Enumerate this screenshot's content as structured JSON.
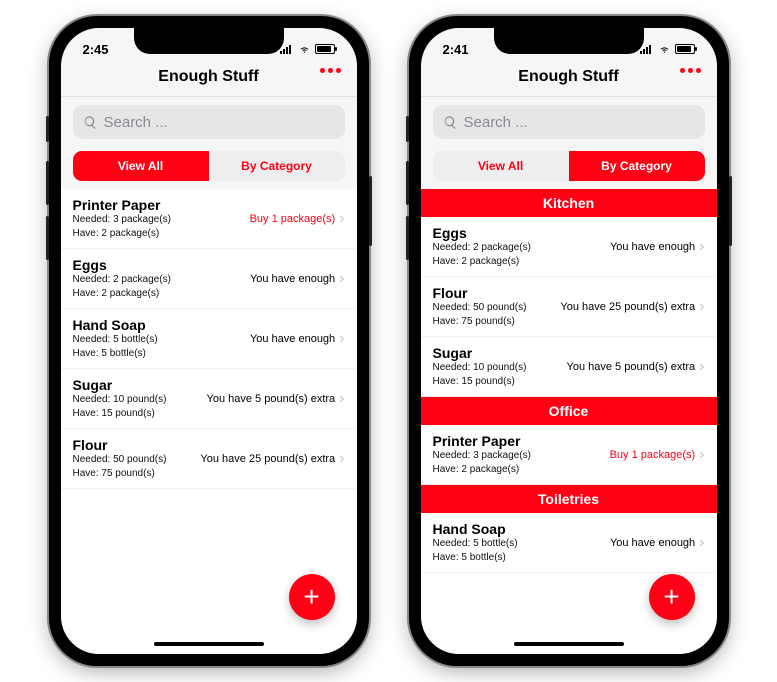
{
  "colors": {
    "accent": "#ff0015"
  },
  "phones": [
    {
      "id": "left",
      "status_time": "2:45",
      "title": "Enough Stuff",
      "search_placeholder": "Search ...",
      "segments": {
        "view_all": "View All",
        "by_category": "By Category",
        "active": "view_all"
      },
      "categories": [],
      "items": [
        {
          "name": "Printer Paper",
          "needed": "Needed: 3 package(s)",
          "have": "Have: 2 package(s)",
          "status": "Buy 1 package(s)",
          "status_kind": "buy"
        },
        {
          "name": "Eggs",
          "needed": "Needed: 2 package(s)",
          "have": "Have: 2 package(s)",
          "status": "You have enough",
          "status_kind": "ok"
        },
        {
          "name": "Hand Soap",
          "needed": "Needed: 5 bottle(s)",
          "have": "Have: 5 bottle(s)",
          "status": "You have enough",
          "status_kind": "ok"
        },
        {
          "name": "Sugar",
          "needed": "Needed: 10 pound(s)",
          "have": "Have: 15 pound(s)",
          "status": "You have 5 pound(s) extra",
          "status_kind": "ok"
        },
        {
          "name": "Flour",
          "needed": "Needed: 50 pound(s)",
          "have": "Have: 75 pound(s)",
          "status": "You have 25 pound(s) extra",
          "status_kind": "ok"
        }
      ]
    },
    {
      "id": "right",
      "status_time": "2:41",
      "title": "Enough Stuff",
      "search_placeholder": "Search ...",
      "segments": {
        "view_all": "View All",
        "by_category": "By Category",
        "active": "by_category"
      },
      "categories": [
        {
          "name": "Kitchen",
          "items": [
            {
              "name": "Eggs",
              "needed": "Needed: 2 package(s)",
              "have": "Have: 2 package(s)",
              "status": "You have enough",
              "status_kind": "ok"
            },
            {
              "name": "Flour",
              "needed": "Needed: 50 pound(s)",
              "have": "Have: 75 pound(s)",
              "status": "You have 25 pound(s) extra",
              "status_kind": "ok"
            },
            {
              "name": "Sugar",
              "needed": "Needed: 10 pound(s)",
              "have": "Have: 15 pound(s)",
              "status": "You have 5 pound(s) extra",
              "status_kind": "ok"
            }
          ]
        },
        {
          "name": "Office",
          "items": [
            {
              "name": "Printer Paper",
              "needed": "Needed: 3 package(s)",
              "have": "Have: 2 package(s)",
              "status": "Buy 1 package(s)",
              "status_kind": "buy"
            }
          ]
        },
        {
          "name": "Toiletries",
          "items": [
            {
              "name": "Hand Soap",
              "needed": "Needed: 5 bottle(s)",
              "have": "Have: 5 bottle(s)",
              "status": "You have enough",
              "status_kind": "ok"
            }
          ]
        }
      ],
      "items": []
    }
  ],
  "icons": {
    "search": "search-icon",
    "more": "more-icon",
    "chevron": "chevron-right-icon",
    "plus": "plus-icon",
    "signal": "signal-icon",
    "wifi": "wifi-icon",
    "battery": "battery-icon"
  }
}
